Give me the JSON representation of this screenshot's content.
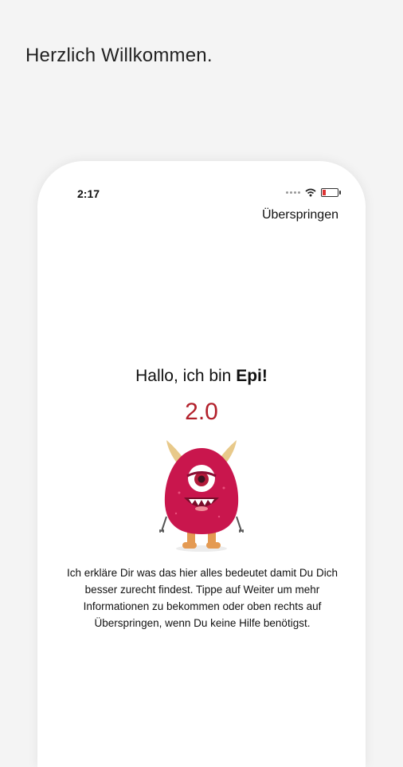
{
  "page": {
    "headline": "Herzlich Willkommen."
  },
  "status_bar": {
    "time": "2:17",
    "icons": [
      "signal-dots-icon",
      "wifi-icon",
      "battery-icon"
    ],
    "battery_color": "#dd3333"
  },
  "header": {
    "skip_label": "Überspringen"
  },
  "intro": {
    "greeting_prefix": "Hallo, ich bin ",
    "greeting_name": "Epi!",
    "version": "2.0",
    "version_color": "#b2202b",
    "mascot": "monster-mascot-icon",
    "description": "Ich erkläre Dir was das hier alles bedeutet damit Du Dich besser zurecht findest. Tippe auf Weiter um mehr Informationen zu bekommen oder oben rechts auf Überspringen, wenn Du keine Hilfe benötigst."
  }
}
